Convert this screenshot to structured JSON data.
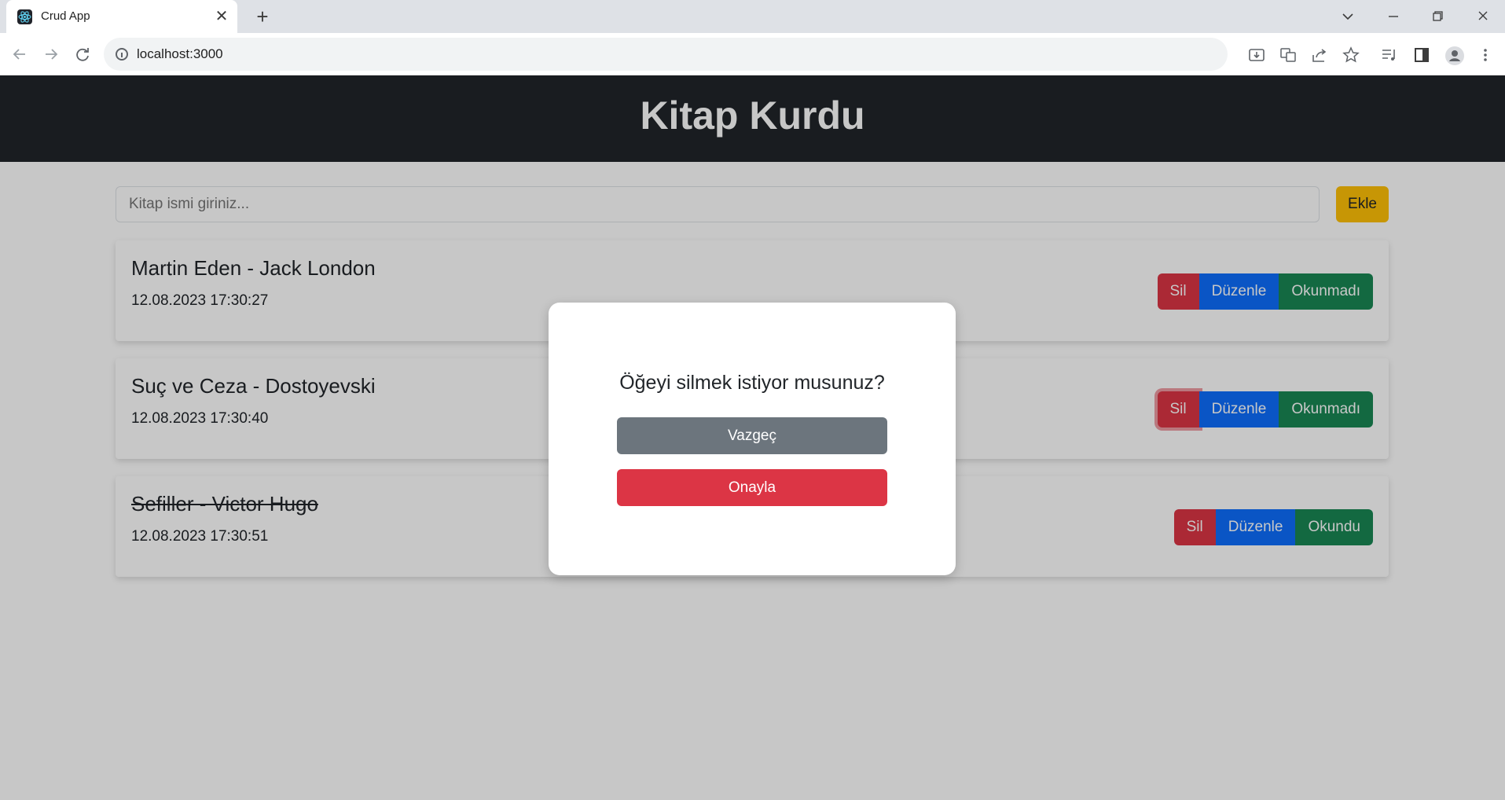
{
  "browser": {
    "tab_title": "Crud App",
    "tab_close_glyph": "✕",
    "new_tab_glyph": "+",
    "url": "localhost:3000"
  },
  "app": {
    "title": "Kitap Kurdu",
    "search_placeholder": "Kitap ismi giriniz...",
    "add_label": "Ekle"
  },
  "books": [
    {
      "title": "Martin Eden - Jack London",
      "date": "12.08.2023 17:30:27",
      "read": false,
      "delete_label": "Sil",
      "edit_label": "Düzenle",
      "status_label": "Okunmadı"
    },
    {
      "title": "Suç ve Ceza - Dostoyevski",
      "date": "12.08.2023 17:30:40",
      "read": false,
      "delete_label": "Sil",
      "edit_label": "Düzenle",
      "status_label": "Okunmadı"
    },
    {
      "title": "Sefiller - Victor Hugo",
      "date": "12.08.2023 17:30:51",
      "read": true,
      "delete_label": "Sil",
      "edit_label": "Düzenle",
      "status_label": "Okundu"
    }
  ],
  "modal": {
    "question": "Öğeyi silmek istiyor musunuz?",
    "cancel_label": "Vazgeç",
    "confirm_label": "Onayla"
  },
  "colors": {
    "header": "#212529",
    "warning": "#ffc107",
    "danger": "#dc3545",
    "primary": "#0d6efd",
    "success": "#198754",
    "secondary": "#6c757d"
  }
}
